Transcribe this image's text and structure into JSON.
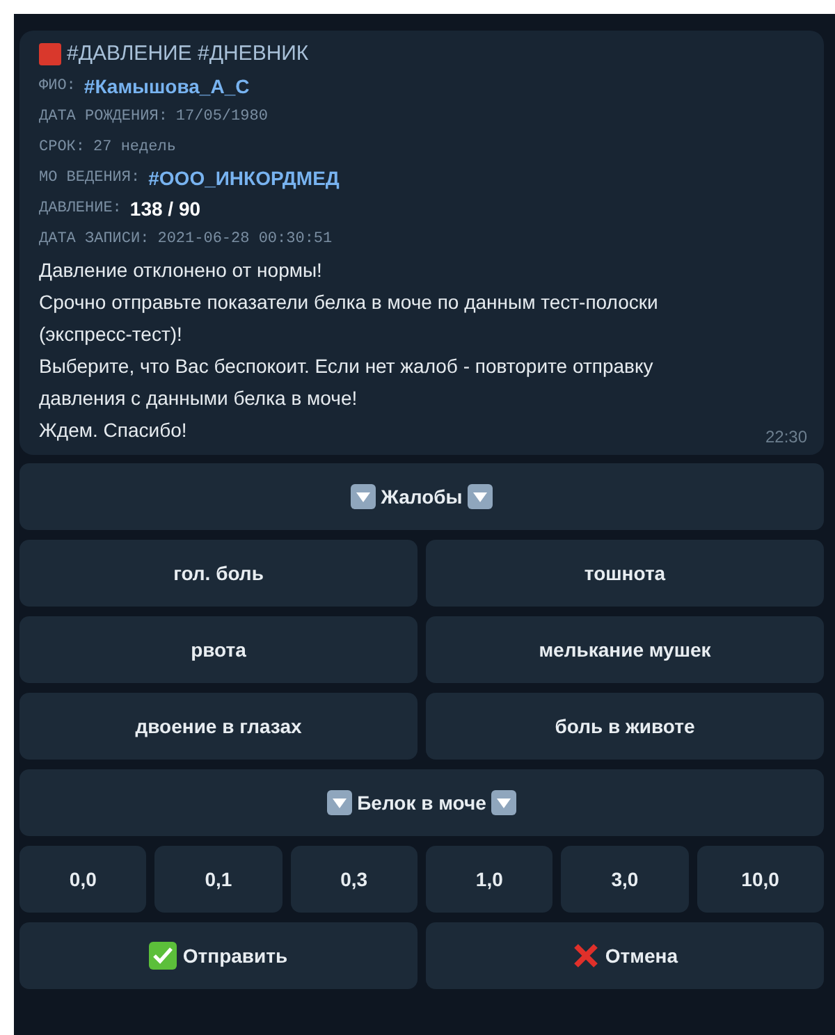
{
  "message": {
    "title": "#ДАВЛЕНИЕ #ДНЕВНИК",
    "fields": [
      {
        "label": "ФИО:",
        "value": "#Камышова_А_С",
        "kind": "tag"
      },
      {
        "label": "ДАТА РОЖДЕНИЯ:",
        "value": "17/05/1980",
        "kind": "plain"
      },
      {
        "label": "СРОК:",
        "value": "27 недель",
        "kind": "plain"
      },
      {
        "label": "МО ВЕДЕНИЯ:",
        "value": "#ООО_ИНКОРДМЕД",
        "kind": "tag"
      },
      {
        "label": "ДАВЛЕНИЕ:",
        "value": "138 / 90",
        "kind": "bold"
      },
      {
        "label": "ДАТА ЗАПИСИ:",
        "value": "2021-06-28 00:30:51",
        "kind": "plain"
      }
    ],
    "paragraphs": [
      "Давление отклонено от нормы!",
      "Срочно отправьте показатели белка в моче по данным тест-полоски (экспресс-тест)!",
      "Выберите, что Вас беспокоит. Если нет жалоб - повторите отправку давления с данными белка в моче!",
      "Ждем. Спасибо!"
    ],
    "time": "22:30"
  },
  "keyboard": [
    [
      {
        "label": "Жалобы",
        "kind": "header"
      }
    ],
    [
      {
        "label": "гол. боль",
        "kind": "plain"
      },
      {
        "label": "тошнота",
        "kind": "plain"
      }
    ],
    [
      {
        "label": "рвота",
        "kind": "plain"
      },
      {
        "label": "мелькание мушек",
        "kind": "plain"
      }
    ],
    [
      {
        "label": "двоение в глазах",
        "kind": "plain"
      },
      {
        "label": "боль в животе",
        "kind": "plain"
      }
    ],
    [
      {
        "label": "Белок в моче",
        "kind": "header"
      }
    ],
    [
      {
        "label": "0,0",
        "kind": "plain"
      },
      {
        "label": "0,1",
        "kind": "plain"
      },
      {
        "label": "0,3",
        "kind": "plain"
      },
      {
        "label": "1,0",
        "kind": "plain"
      },
      {
        "label": "3,0",
        "kind": "plain"
      },
      {
        "label": "10,0",
        "kind": "plain"
      }
    ],
    [
      {
        "label": "Отправить",
        "kind": "send"
      },
      {
        "label": "Отмена",
        "kind": "cancel"
      }
    ]
  ]
}
